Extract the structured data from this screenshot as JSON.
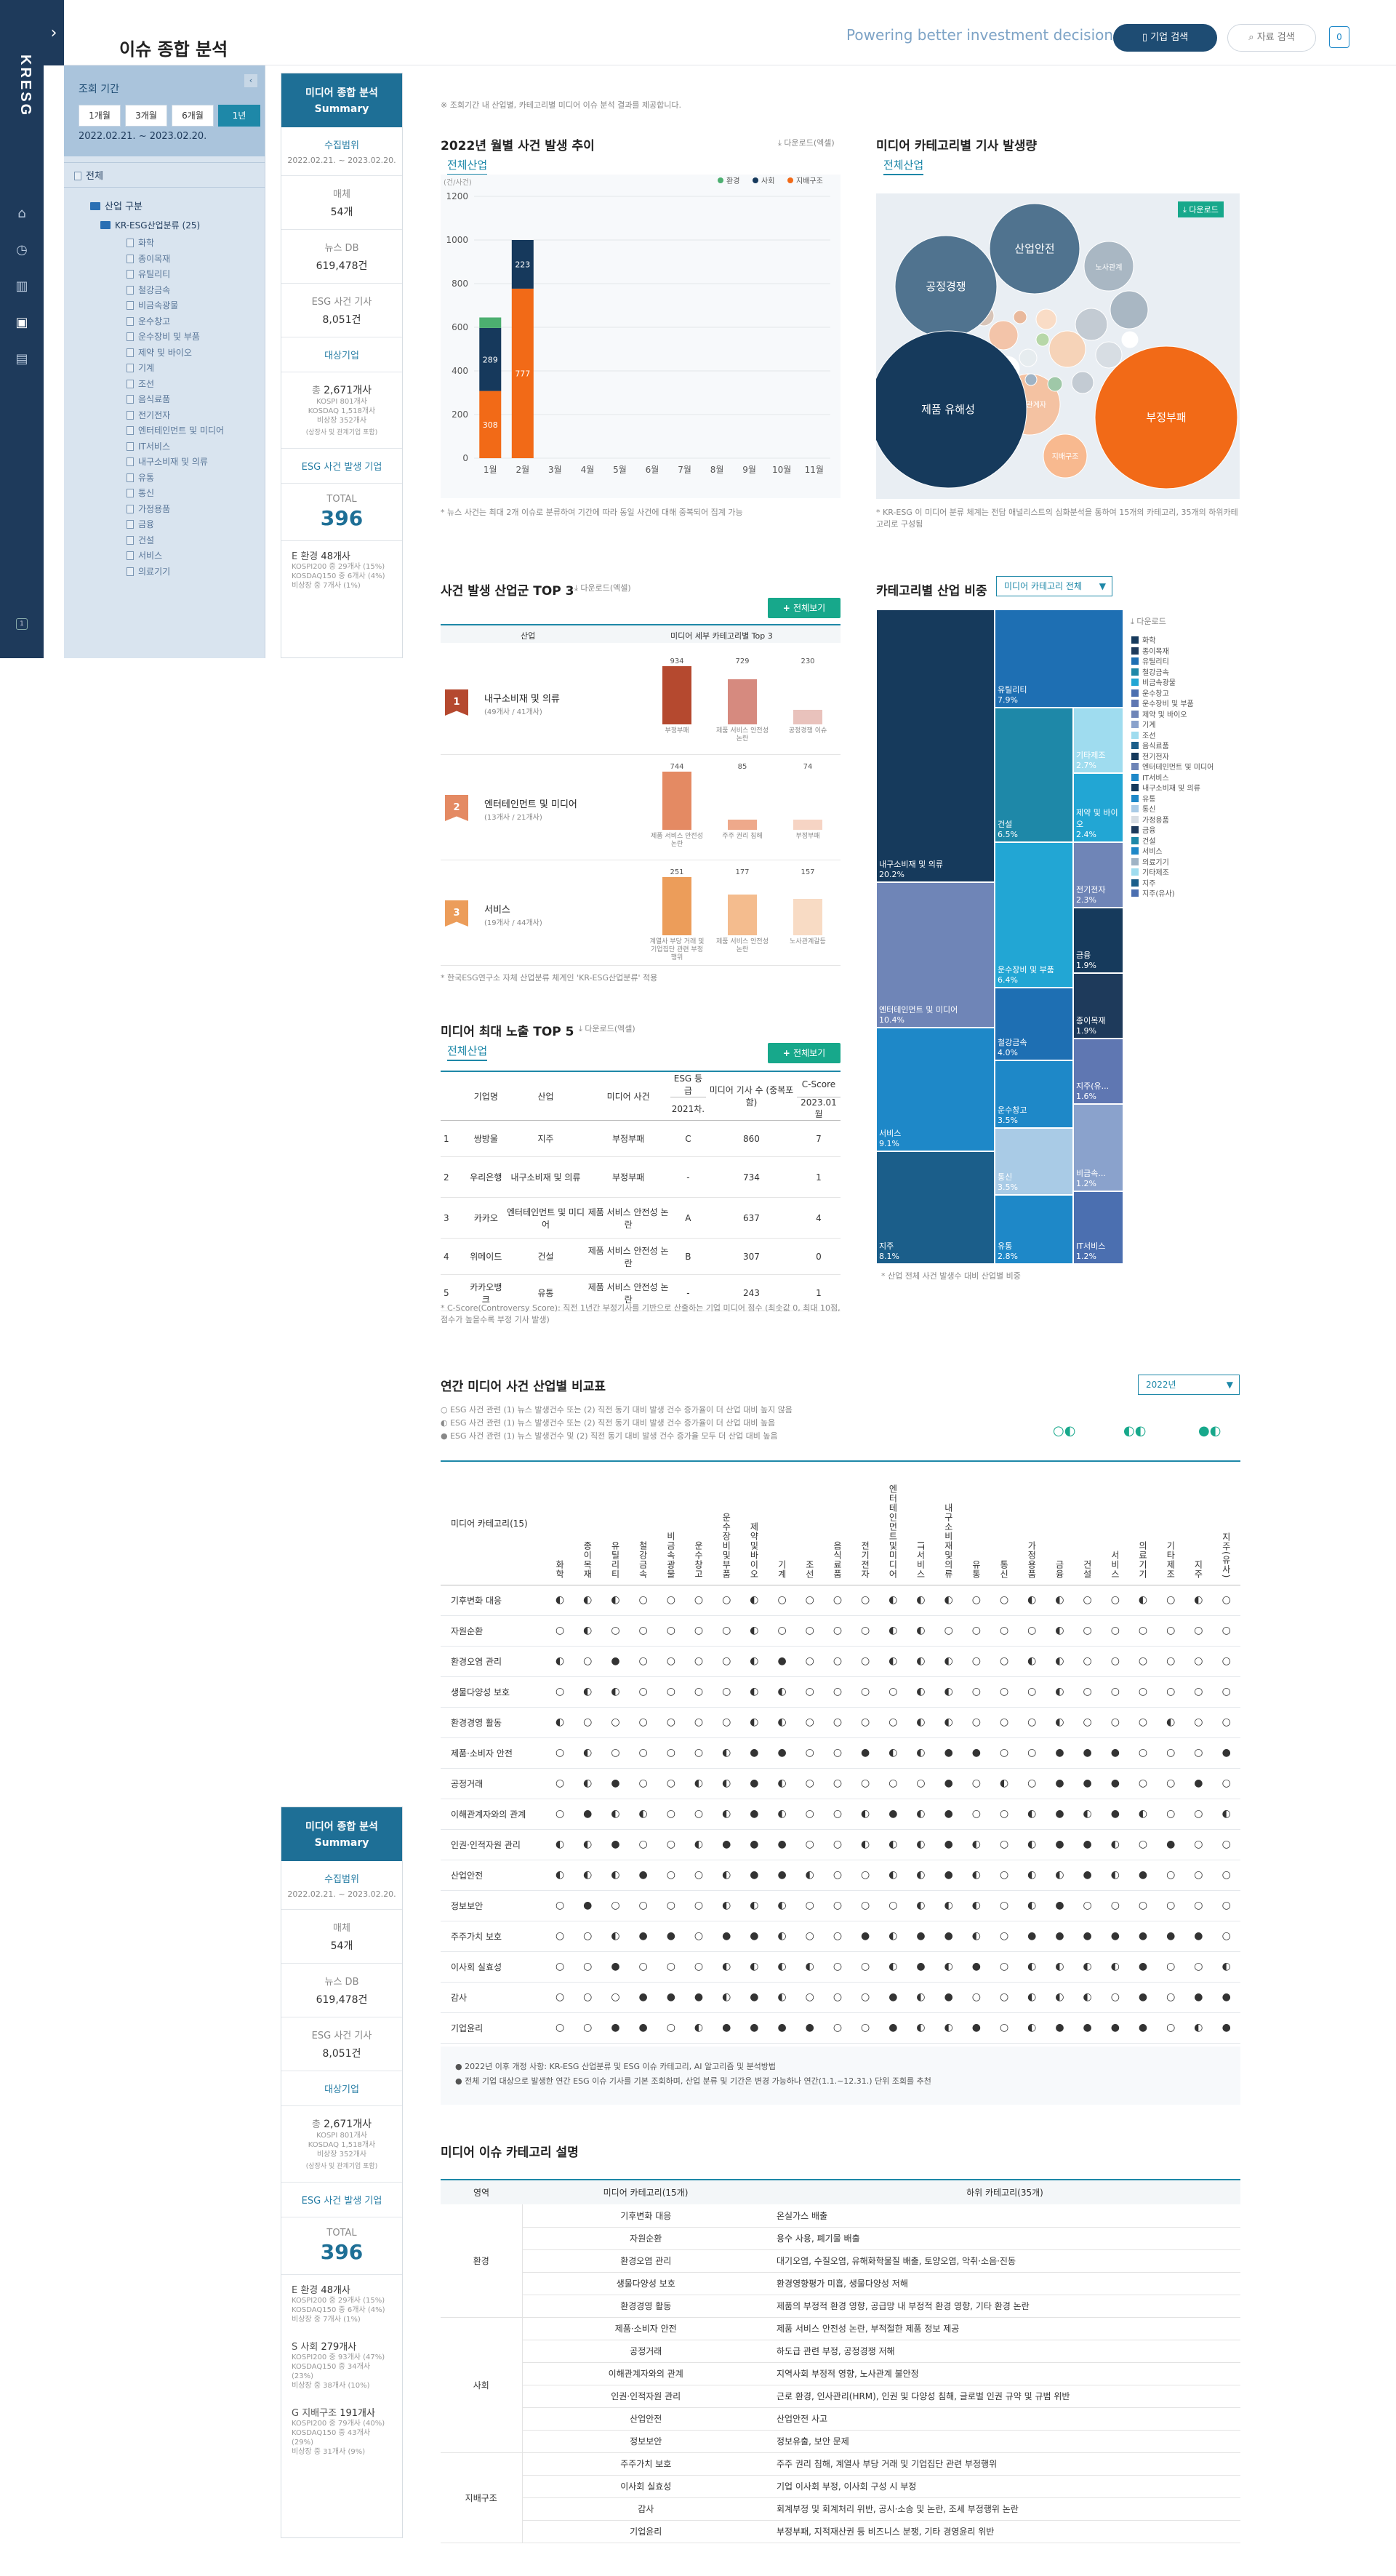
{
  "app": {
    "logo": "KRESG",
    "page_title": "이슈 종합 분석",
    "tagline": "Powering better investment decision",
    "btn_company": "기업 검색",
    "btn_search": "자료 검색",
    "notif_count": "0",
    "rail_badge": "1",
    "expand_icon": "chevron-right-icon"
  },
  "colors": {
    "navy": "#1e3a5b",
    "teal": "#1e88a8",
    "green": "#17a88b",
    "orange": "#f26a17",
    "red": "#b5492f"
  },
  "left_panel": {
    "period_label": "조회 기간",
    "periods": [
      "1개월",
      "3개월",
      "6개월",
      "1년"
    ],
    "selected_period": "1년",
    "date_range": "2022.02.21. ~ 2023.02.20.",
    "all_label": "전체",
    "industry_label": "산업 구분",
    "root": "KR-ESG산업분류 (25)",
    "items": [
      "화학",
      "종이목재",
      "유틸리티",
      "철강금속",
      "비금속광물",
      "운수창고",
      "운수장비 및 부품",
      "제약 및 바이오",
      "기계",
      "조선",
      "음식료품",
      "전기전자",
      "엔터테인먼트 및 미디어",
      "IT서비스",
      "내구소비재 및 의류",
      "유통",
      "통신",
      "가정용품",
      "금융",
      "건설",
      "서비스",
      "의료기기"
    ]
  },
  "summary": {
    "title": "미디어 종합 분석",
    "title_en": "Summary",
    "scope_title": "수집범위",
    "scope_range": "2022.02.21. ~ 2023.02.20.",
    "media_label": "매체",
    "media_value": "54개",
    "newsdb_label": "뉴스 DB",
    "newsdb_value": "619,478건",
    "esg_label": "ESG 사건 기사",
    "esg_value": "8,051건",
    "target_title": "대상기업",
    "total_label": "총",
    "total_value": "2,671개사",
    "kospi": "KOSPI 801개사",
    "kosdaq": "KOSDAQ 1,518개사",
    "nonlisted": "비상장 352개사",
    "target_note": "(상장사 및 관계기업 포함)",
    "event_title": "ESG 사건 발생 기업",
    "event_total_label": "TOTAL",
    "event_total": "396",
    "e_label": "E 환경",
    "e_value": "48개사",
    "e_sub": [
      "KOSPI200 중 29개사 (15%)",
      "KOSDAQ150 중 6개사 (4%)",
      "비상장 중 7개사 (1%)"
    ],
    "s_label": "S 사회",
    "s_value": "279개사",
    "s_sub": [
      "KOSPI200 중 93개사 (47%)",
      "KOSDAQ150 중 34개사 (23%)",
      "비상장 중 38개사 (10%)"
    ],
    "g_label": "G 지배구조",
    "g_value": "191개사",
    "g_sub": [
      "KOSPI200 중 79개사 (40%)",
      "KOSDAQ150 중 43개사 (29%)",
      "비상장 중 31개사 (9%)"
    ]
  },
  "intro_note": "※ 조회기간 내 산업별, 카테고리별 미디어 이슈 분석 결과를 제공합니다.",
  "monthly": {
    "title": "2022년 월별 사건 발생 추이",
    "tab": "전체산업",
    "download": "다운로드(엑셀)",
    "unit": "(건/사건)",
    "note": "* 뉴스 사건는 최대 2개 이슈로 분류하여 기간에 따라 동일 사건에 대해 중복되어 집계 가능",
    "chart_data": {
      "type": "bar",
      "stacked": true,
      "categories": [
        "1월",
        "2월",
        "3월",
        "4월",
        "5월",
        "6월",
        "7월",
        "8월",
        "9월",
        "10월",
        "11월"
      ],
      "ylim": [
        0,
        1200
      ],
      "yticks": [
        0,
        200,
        400,
        600,
        800,
        1000,
        1200
      ],
      "legend_position": "top-right",
      "series": [
        {
          "name": "지배구조",
          "color": "#f26a17",
          "values": [
            308,
            777,
            0,
            0,
            0,
            0,
            0,
            0,
            0,
            0,
            0
          ]
        },
        {
          "name": "사회",
          "color": "#16395c",
          "values": [
            289,
            223,
            0,
            0,
            0,
            0,
            0,
            0,
            0,
            0,
            0
          ]
        },
        {
          "name": "환경",
          "color": "#4caf70",
          "values": [
            48,
            0,
            0,
            0,
            0,
            0,
            0,
            0,
            0,
            0,
            0
          ]
        }
      ]
    }
  },
  "bubble": {
    "title": "미디어 카테고리별 기사 발생량",
    "tab": "전체산업",
    "download": "다운로드",
    "note": "* KR-ESG 이 미디어 분류 체계는 전담 애널리스트의 심화분석을 통하여 15개의 카테고리, 35개의 하위카테고리로 구성됨",
    "labels": [
      "산업안전",
      "공정경쟁",
      "노사관계",
      "제품 유해성",
      "부정부패",
      "이해관계자",
      "지배구조"
    ]
  },
  "top3": {
    "title": "사건 발생 산업군 TOP 3",
    "download": "다운로드(엑셀)",
    "button": "전체보기",
    "col_industry": "산업",
    "col_cat": "미디어 세부 카테고리별 Top 3",
    "note": "* 한국ESG연구소 자체 산업분류 체계인 'KR-ESG산업분류' 적용",
    "rows": [
      {
        "rank": "1",
        "name": "내구소비재 및 의류",
        "sub": "(49개사 / 41개사)",
        "bars": [
          {
            "v": "934",
            "l": "부정부패"
          },
          {
            "v": "729",
            "l": "제품 서비스 안전성 논란"
          },
          {
            "v": "230",
            "l": "공정경쟁 이슈"
          }
        ]
      },
      {
        "rank": "2",
        "name": "엔터테인먼트 및 미디어",
        "sub": "(13개사 / 21개사)",
        "bars": [
          {
            "v": "744",
            "l": "제품 서비스 안전성 논란"
          },
          {
            "v": "85",
            "l": "주주 권리 침해"
          },
          {
            "v": "74",
            "l": "부정부패"
          }
        ]
      },
      {
        "rank": "3",
        "name": "서비스",
        "sub": "(19개사 / 44개사)",
        "bars": [
          {
            "v": "251",
            "l": "계열사 부당 거래 및 기업집단 관련 부정행위"
          },
          {
            "v": "177",
            "l": "제품 서비스 안전성 논란"
          },
          {
            "v": "157",
            "l": "노사관계갈등"
          }
        ]
      }
    ]
  },
  "top5": {
    "title": "미디어 최대 노출 TOP 5",
    "tab": "전체산업",
    "download": "다운로드(엑셀)",
    "button": "전체보기",
    "headers": [
      "기업명",
      "산업",
      "미디어 사건",
      "ESG 등급",
      "2021차.",
      "미디어 기사 수 (중복포함)",
      "C-Score",
      "2023.01월"
    ],
    "rows": [
      [
        "1",
        "쌍방울",
        "지주",
        "부정부패",
        "C",
        "860",
        "7"
      ],
      [
        "2",
        "우리은행",
        "내구소비재 및 의류",
        "부정부패",
        "-",
        "734",
        "1"
      ],
      [
        "3",
        "카카오",
        "엔터테인먼트 및 미디어",
        "제품 서비스 안전성 논란",
        "A",
        "637",
        "4"
      ],
      [
        "4",
        "위메이드",
        "건설",
        "제품 서비스 안전성 논란",
        "B",
        "307",
        "0"
      ],
      [
        "5",
        "카카오뱅크",
        "유통",
        "제품 서비스 안전성 논란",
        "-",
        "243",
        "1"
      ]
    ],
    "note": "* C-Score(Controversy Score): 직전 1년간 부정기사를 기반으로 산출하는 기업 미디어 점수 (최솟값 0, 최대 10점, 점수가 높을수록 부정 기사 발생)"
  },
  "treemap": {
    "title": "카테고리별 산업 비중",
    "select": "미디어 카테고리 전체",
    "download": "다운로드",
    "note": "* 산업 전체 사건 발생수 대비 산업별 비중",
    "cells": [
      [
        "내구소비재 및 의류",
        "20.2%"
      ],
      [
        "엔터테인먼트 및 미디어",
        "10.4%"
      ],
      [
        "서비스",
        "9.1%"
      ],
      [
        "지주",
        "8.1%"
      ],
      [
        "유틸리티",
        "7.9%"
      ],
      [
        "건설",
        "6.5%"
      ],
      [
        "운수장비 및 부품",
        "6.4%"
      ],
      [
        "철강금속",
        "4.0%"
      ],
      [
        "운수창고",
        "3.5%"
      ],
      [
        "통신",
        "3.5%"
      ],
      [
        "유통",
        "2.8%"
      ],
      [
        "기타제조",
        "2.7%"
      ],
      [
        "제약 및 바이오",
        "2.4%"
      ],
      [
        "전기전자",
        "2.3%"
      ],
      [
        "금융",
        "1.9%"
      ],
      [
        "종이목재",
        "1.9%"
      ],
      [
        "지주(유...",
        "1.6%"
      ],
      [
        "비금속...",
        "1.2%"
      ],
      [
        "IT서비스",
        "1.2%"
      ]
    ],
    "legend": [
      "화학",
      "종이목재",
      "유틸리티",
      "철강금속",
      "비금속광물",
      "운수창고",
      "운수장비 및 부품",
      "제약 및 바이오",
      "기계",
      "조선",
      "음식료품",
      "전기전자",
      "엔터테인먼트 및 미디어",
      "IT서비스",
      "내구소비재 및 의류",
      "유통",
      "통신",
      "가정용품",
      "금융",
      "건설",
      "서비스",
      "의료기기",
      "기타제조",
      "지주",
      "지주(유사)"
    ]
  },
  "matrix": {
    "title": "연간 미디어 사건 산업별 비교표",
    "year": "2022년",
    "legend": [
      "○ ESG 사건 관련 (1) 뉴스 발생건수 또는 (2) 직전 동기 대비 발생 건수 증가율이 더 산업 대비 높지 않음",
      "◐ ESG 사건 관련 (1) 뉴스 발생건수 또는 (2) 직전 동기 대비 발생 건수 증가율이 더 산업 대비 높음",
      "● ESG 사건 관련 (1) 뉴스 발생건수 및 (2) 직전 동기 대비 발생 건수 증가율 모두 더 산업 대비 높음"
    ],
    "corner": "미디어 카테고리(15)",
    "cols": [
      "화학",
      "종이목재",
      "유틸리티",
      "철강금속",
      "비금속광물",
      "운수창고",
      "운수장비및부품",
      "제약및바이오",
      "기계",
      "조선",
      "음식료품",
      "전기전자",
      "엔터테인먼트및미디어",
      "IT서비스",
      "내구소비재및의류",
      "유통",
      "통신",
      "가정용품",
      "금융",
      "건설",
      "서비스",
      "의료기기",
      "기타제조",
      "지주",
      "지주(유사)"
    ],
    "rows": [
      {
        "n": "기후변화 대응",
        "v": "hhhoooohoooohhhoohhoohoho"
      },
      {
        "n": "자원순환",
        "v": "ohooooohoooohhoooohoooooo"
      },
      {
        "n": "환경오염 관리",
        "v": "hofoooohfooohhhoohhoooooo"
      },
      {
        "n": "생물다양성 보호",
        "v": "ohhoooohhoooohhooohoooooo"
      },
      {
        "n": "환경경영 활동",
        "v": "hoooooohhoooohhooohooohoo"
      },
      {
        "n": "제품·소비자 안전",
        "v": "ohoooohffoofhhffoofffoooff"
      },
      {
        "n": "공정거래",
        "v": "ohfoohhfhooooofohofffoofof"
      },
      {
        "n": "이해관계자와의 관계",
        "v": "ofhhoohfhoohfhfoohfhfhoohf"
      },
      {
        "n": "인권·인적자원 관리",
        "v": "hhfoohfffoohhhfhohffhofoof"
      },
      {
        "n": "산업안전",
        "v": "hhhfoohffhoohhfhohhfhfoooh"
      },
      {
        "n": "정보보안",
        "v": "ofoooohhhoooohhhohfoooooo"
      },
      {
        "n": "주주가치 보호",
        "v": "oohffoffhoofhffhofffffffo"
      },
      {
        "n": "이사회 실효성",
        "v": "oofooohhhhoohfhfohhhhfooho"
      },
      {
        "n": "감사",
        "v": "ooofffhfhooofhfoohhhofoffo"
      },
      {
        "n": "기업윤리",
        "v": "ooffohffffoofhhfohffffohff"
      }
    ]
  },
  "matrix_notes": [
    "● 2022년 이후 개정 사항: KR-ESG 산업분류 및 ESG 이슈 카테고리, AI 알고리즘 및 분석방법",
    "● 전체 기업 대상으로 발생한 연간 ESG 이슈 기사를 기본 조회하며, 산업 분류 및 기간은 변경 가능하나 연간(1.1.~12.31.) 단위 조회를 추천"
  ],
  "desc": {
    "title": "미디어 이슈 카테고리 설명",
    "headers": [
      "영역",
      "미디어 카테고리(15개)",
      "하위 카테고리(35개)"
    ],
    "groups": [
      {
        "area": "환경",
        "rows": [
          [
            "기후변화 대응",
            "온실가스 배출"
          ],
          [
            "자원순환",
            "용수 사용, 폐기물 배출"
          ],
          [
            "환경오염 관리",
            "대기오염, 수질오염, 유해화학물질 배출, 토양오염, 악취·소음·진동"
          ],
          [
            "생물다양성 보호",
            "환경영향평가 미흡, 생물다양성 저해"
          ],
          [
            "환경경영 활동",
            "제품의 부정적 환경 영향, 공급망 내 부정적 환경 영향, 기타 환경 논란"
          ]
        ]
      },
      {
        "area": "사회",
        "rows": [
          [
            "제품·소비자 안전",
            "제품 서비스 안전성 논란, 부적절한 제품 정보 제공"
          ],
          [
            "공정거래",
            "하도급 관련 부정, 공정경쟁 저해"
          ],
          [
            "이해관계자와의 관계",
            "지역사회 부정적 영향, 노사관계 불안정"
          ],
          [
            "인권·인적자원 관리",
            "근로 환경, 인사관리(HRM), 인권 및 다양성 침해, 글로벌 인권 규약 및 규범 위반"
          ],
          [
            "산업안전",
            "산업안전 사고"
          ],
          [
            "정보보안",
            "정보유출, 보안 문제"
          ]
        ]
      },
      {
        "area": "지배구조",
        "rows": [
          [
            "주주가치 보호",
            "주주 권리 침해, 계열사 부당 거래 및 기업집단 관련 부정행위"
          ],
          [
            "이사회 실효성",
            "기업 이사회 부정, 이사회 구성 시 부정"
          ],
          [
            "감사",
            "회계부정 및 회계처리 위반, 공시·소송 및 논란, 조세 부정행위 논란"
          ],
          [
            "기업윤리",
            "부정부패, 지적재산권 등 비즈니스 분쟁, 기타 경영윤리 위반"
          ]
        ]
      }
    ]
  }
}
